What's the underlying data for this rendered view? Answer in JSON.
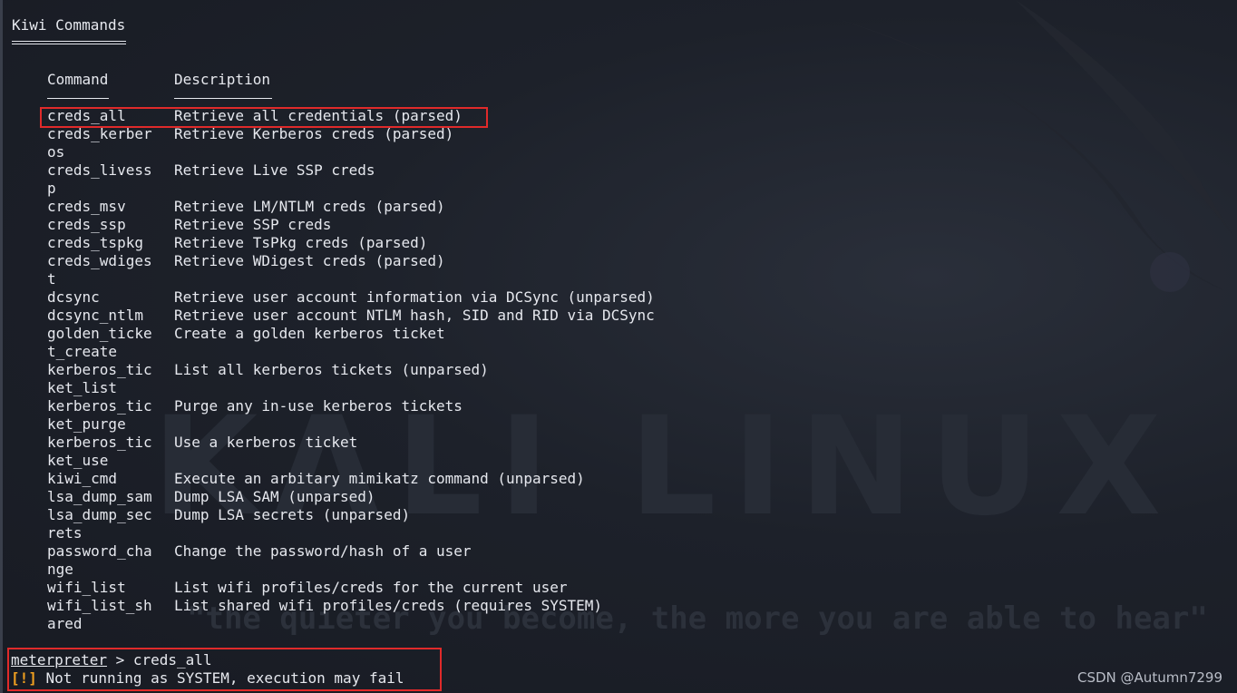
{
  "section_title": "Kiwi Commands",
  "columns": {
    "command": "Command",
    "description": "Description"
  },
  "rows": [
    {
      "cmd": [
        "creds_all"
      ],
      "desc": "Retrieve all credentials (parsed)",
      "highlighted": true
    },
    {
      "cmd": [
        "creds_kerber",
        "os"
      ],
      "desc": "Retrieve Kerberos creds (parsed)"
    },
    {
      "cmd": [
        "creds_livess",
        "p"
      ],
      "desc": "Retrieve Live SSP creds"
    },
    {
      "cmd": [
        "creds_msv"
      ],
      "desc": "Retrieve LM/NTLM creds (parsed)"
    },
    {
      "cmd": [
        "creds_ssp"
      ],
      "desc": "Retrieve SSP creds"
    },
    {
      "cmd": [
        "creds_tspkg"
      ],
      "desc": "Retrieve TsPkg creds (parsed)"
    },
    {
      "cmd": [
        "creds_wdiges",
        "t"
      ],
      "desc": "Retrieve WDigest creds (parsed)"
    },
    {
      "cmd": [
        "dcsync"
      ],
      "desc": "Retrieve user account information via DCSync (unparsed)"
    },
    {
      "cmd": [
        "dcsync_ntlm"
      ],
      "desc": "Retrieve user account NTLM hash, SID and RID via DCSync"
    },
    {
      "cmd": [
        "golden_ticke",
        "t_create"
      ],
      "desc": "Create a golden kerberos ticket"
    },
    {
      "cmd": [
        "kerberos_tic",
        "ket_list"
      ],
      "desc": "List all kerberos tickets (unparsed)"
    },
    {
      "cmd": [
        "kerberos_tic",
        "ket_purge"
      ],
      "desc": "Purge any in-use kerberos tickets"
    },
    {
      "cmd": [
        "kerberos_tic",
        "ket_use"
      ],
      "desc": "Use a kerberos ticket"
    },
    {
      "cmd": [
        "kiwi_cmd"
      ],
      "desc": "Execute an arbitary mimikatz command (unparsed)"
    },
    {
      "cmd": [
        "lsa_dump_sam"
      ],
      "desc": "Dump LSA SAM (unparsed)"
    },
    {
      "cmd": [
        "lsa_dump_sec",
        "rets"
      ],
      "desc": "Dump LSA secrets (unparsed)"
    },
    {
      "cmd": [
        "password_cha",
        "nge"
      ],
      "desc": "Change the password/hash of a user"
    },
    {
      "cmd": [
        "wifi_list"
      ],
      "desc": "List wifi profiles/creds for the current user"
    },
    {
      "cmd": [
        "wifi_list_sh",
        "ared"
      ],
      "desc": "List shared wifi profiles/creds (requires SYSTEM)"
    }
  ],
  "prompt": {
    "name": "meterpreter",
    "separator": " > ",
    "command": "creds_all"
  },
  "warning": {
    "tag": "[!]",
    "text": " Not running as SYSTEM, execution may fail"
  },
  "watermark": {
    "title": "KALI LINUX",
    "slogan": "\"the quieter you become, the more you are able to hear\""
  },
  "credit": "CSDN @Autumn7299",
  "colors": {
    "background": "#1d212a",
    "text": "#e6e8ee",
    "highlight_box": "#e02a2a",
    "warning_tag": "#f0a020"
  }
}
